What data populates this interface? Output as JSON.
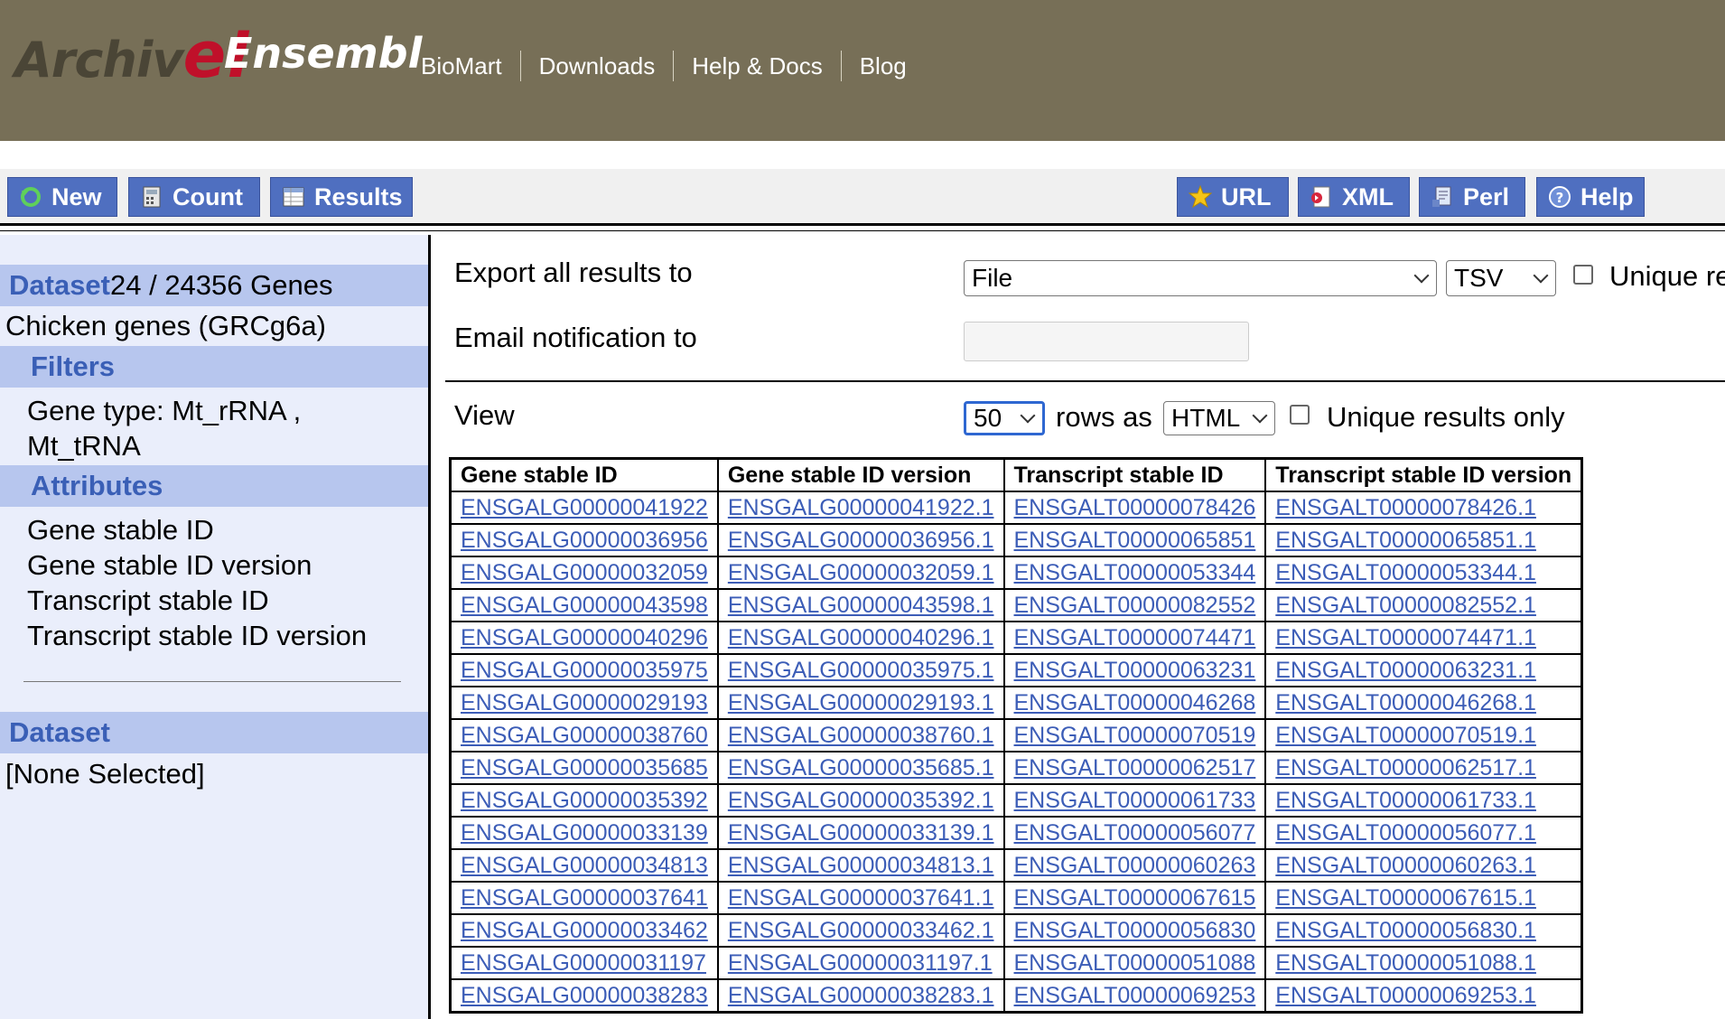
{
  "header": {
    "logo_archive_prefix": "Archiv",
    "logo_archive_e": "e!",
    "logo_ensembl": "Ensembl",
    "nav": [
      "BioMart",
      "Downloads",
      "Help & Docs",
      "Blog"
    ]
  },
  "toolbar": {
    "new_label": "New",
    "count_label": "Count",
    "results_label": "Results",
    "url_label": "URL",
    "xml_label": "XML",
    "perl_label": "Perl",
    "help_label": "Help"
  },
  "sidebar": {
    "dataset1_key": "Dataset",
    "dataset1_count": " 24 / 24356 Genes",
    "dataset1_name": "Chicken genes (GRCg6a)",
    "filters_label": "Filters",
    "filter_line1": "Gene type: Mt_rRNA ,",
    "filter_line2": "Mt_tRNA",
    "attributes_label": "Attributes",
    "attributes": [
      "Gene stable ID",
      "Gene stable ID version",
      "Transcript stable ID",
      "Transcript stable ID version"
    ],
    "dataset2_key": "Dataset",
    "dataset2_value": "[None Selected]"
  },
  "export": {
    "label": "Export  all results to",
    "destination": "File",
    "format": "TSV",
    "unique_label": "Unique re",
    "email_label": "Email notification to",
    "email_value": ""
  },
  "view": {
    "label": "View",
    "rows": "50",
    "rows_as": "rows as",
    "format": "HTML",
    "unique_label": "Unique results only"
  },
  "colors": {
    "masthead": "#776f57",
    "button": "#4f6fc0",
    "panel_head": "#b7c6ee",
    "panel_bg": "#eaeefb",
    "link": "#3c5db7"
  },
  "table": {
    "headers": [
      "Gene stable ID",
      "Gene stable ID version",
      "Transcript stable ID",
      "Transcript stable ID version"
    ],
    "rows": [
      [
        "ENSGALG00000041922",
        "ENSGALG00000041922.1",
        "ENSGALT00000078426",
        "ENSGALT00000078426.1"
      ],
      [
        "ENSGALG00000036956",
        "ENSGALG00000036956.1",
        "ENSGALT00000065851",
        "ENSGALT00000065851.1"
      ],
      [
        "ENSGALG00000032059",
        "ENSGALG00000032059.1",
        "ENSGALT00000053344",
        "ENSGALT00000053344.1"
      ],
      [
        "ENSGALG00000043598",
        "ENSGALG00000043598.1",
        "ENSGALT00000082552",
        "ENSGALT00000082552.1"
      ],
      [
        "ENSGALG00000040296",
        "ENSGALG00000040296.1",
        "ENSGALT00000074471",
        "ENSGALT00000074471.1"
      ],
      [
        "ENSGALG00000035975",
        "ENSGALG00000035975.1",
        "ENSGALT00000063231",
        "ENSGALT00000063231.1"
      ],
      [
        "ENSGALG00000029193",
        "ENSGALG00000029193.1",
        "ENSGALT00000046268",
        "ENSGALT00000046268.1"
      ],
      [
        "ENSGALG00000038760",
        "ENSGALG00000038760.1",
        "ENSGALT00000070519",
        "ENSGALT00000070519.1"
      ],
      [
        "ENSGALG00000035685",
        "ENSGALG00000035685.1",
        "ENSGALT00000062517",
        "ENSGALT00000062517.1"
      ],
      [
        "ENSGALG00000035392",
        "ENSGALG00000035392.1",
        "ENSGALT00000061733",
        "ENSGALT00000061733.1"
      ],
      [
        "ENSGALG00000033139",
        "ENSGALG00000033139.1",
        "ENSGALT00000056077",
        "ENSGALT00000056077.1"
      ],
      [
        "ENSGALG00000034813",
        "ENSGALG00000034813.1",
        "ENSGALT00000060263",
        "ENSGALT00000060263.1"
      ],
      [
        "ENSGALG00000037641",
        "ENSGALG00000037641.1",
        "ENSGALT00000067615",
        "ENSGALT00000067615.1"
      ],
      [
        "ENSGALG00000033462",
        "ENSGALG00000033462.1",
        "ENSGALT00000056830",
        "ENSGALT00000056830.1"
      ],
      [
        "ENSGALG00000031197",
        "ENSGALG00000031197.1",
        "ENSGALT00000051088",
        "ENSGALT00000051088.1"
      ],
      [
        "ENSGALG00000038283",
        "ENSGALG00000038283.1",
        "ENSGALT00000069253",
        "ENSGALT00000069253.1"
      ]
    ]
  }
}
